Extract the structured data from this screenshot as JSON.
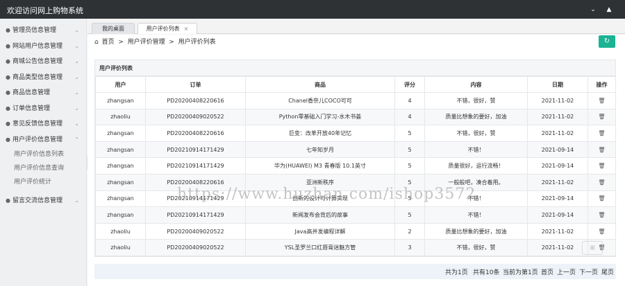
{
  "app": {
    "title": "欢迎访问网上购物系统"
  },
  "topbar": {
    "dropdown_icon": "chevron-down-icon",
    "shirt_icon": "tshirt-icon"
  },
  "sidebar": {
    "items": [
      {
        "label": "管理员信息管理"
      },
      {
        "label": "网站用户信息管理"
      },
      {
        "label": "商城公告信息管理"
      },
      {
        "label": "商品类型信息管理"
      },
      {
        "label": "商品信息管理"
      },
      {
        "label": "订单信息管理"
      },
      {
        "label": "意见反馈信息管理"
      },
      {
        "label": "用户评价信息管理"
      },
      {
        "label": "留言交流信息管理"
      }
    ],
    "subitems": [
      {
        "label": "用户评价信息列表"
      },
      {
        "label": "用户评价信息查询"
      },
      {
        "label": "用户评价统计"
      }
    ]
  },
  "tabs": [
    {
      "label": "我的桌面"
    },
    {
      "label": "用户评价列表",
      "close": "×"
    }
  ],
  "breadcrumb": {
    "home": "首页",
    "level1": "用户评价管理",
    "level2": "用户评价列表",
    "sep": ">"
  },
  "panel": {
    "title": "用户评价列表"
  },
  "table": {
    "headers": [
      "用户",
      "订单",
      "商品",
      "评分",
      "内容",
      "日期",
      "操作"
    ],
    "rows": [
      [
        "zhangsan",
        "PD20200408220616",
        "Chanel香奈儿COCO可可",
        "4",
        "不错，很好，赞",
        "2021-11-02"
      ],
      [
        "zhaoliu",
        "PD20200409020522",
        "Python零基础入门学习-水木书荟",
        "4",
        "质量比想象的要好，加油",
        "2021-11-02"
      ],
      [
        "zhangsan",
        "PD20200408220616",
        "巨变：改革开放40年记忆",
        "5",
        "不错，很好，赞",
        "2021-11-02"
      ],
      [
        "zhangsan",
        "PD20210914171429",
        "七年知岁月",
        "5",
        "不错！",
        "2021-09-14"
      ],
      [
        "zhangsan",
        "PD20210914171429",
        "华为(HUAWEI) M3 青春版 10.1英寸",
        "5",
        "质量很好，运行流畅！",
        "2021-09-14"
      ],
      [
        "zhangsan",
        "PD20200408220616",
        "亚洲新秩序",
        "5",
        "一般般吧，凑合着用。",
        "2021-11-02"
      ],
      [
        "zhangsan",
        "PD20210914171429",
        "创新的设计与计算实现",
        "5",
        "不错！",
        "2021-09-14"
      ],
      [
        "zhangsan",
        "PD20210914171429",
        "新闻发布会背后的故事",
        "5",
        "不错！",
        "2021-09-14"
      ],
      [
        "zhaoliu",
        "PD20200409020522",
        "Java高并发编程详解",
        "2",
        "质量比想象的要好，加油",
        "2021-11-02"
      ],
      [
        "zhaoliu",
        "PD20200409020522",
        "YSL圣罗兰口红唇膏迷魅方管",
        "3",
        "不错，很好，赞",
        "2021-11-02"
      ]
    ]
  },
  "pager": {
    "total_pages": "共为1页",
    "total_records": "共有10条",
    "current": "当前为第1页",
    "first": "首页",
    "prev": "上一页",
    "next": "下一页",
    "last": "尾页"
  },
  "watermark": {
    "text": "https://www.huzhan.com/ishop3572"
  },
  "colors": {
    "topbar": "#2f3235",
    "accent": "#1ab394",
    "sidebar": "#eef0f2"
  }
}
